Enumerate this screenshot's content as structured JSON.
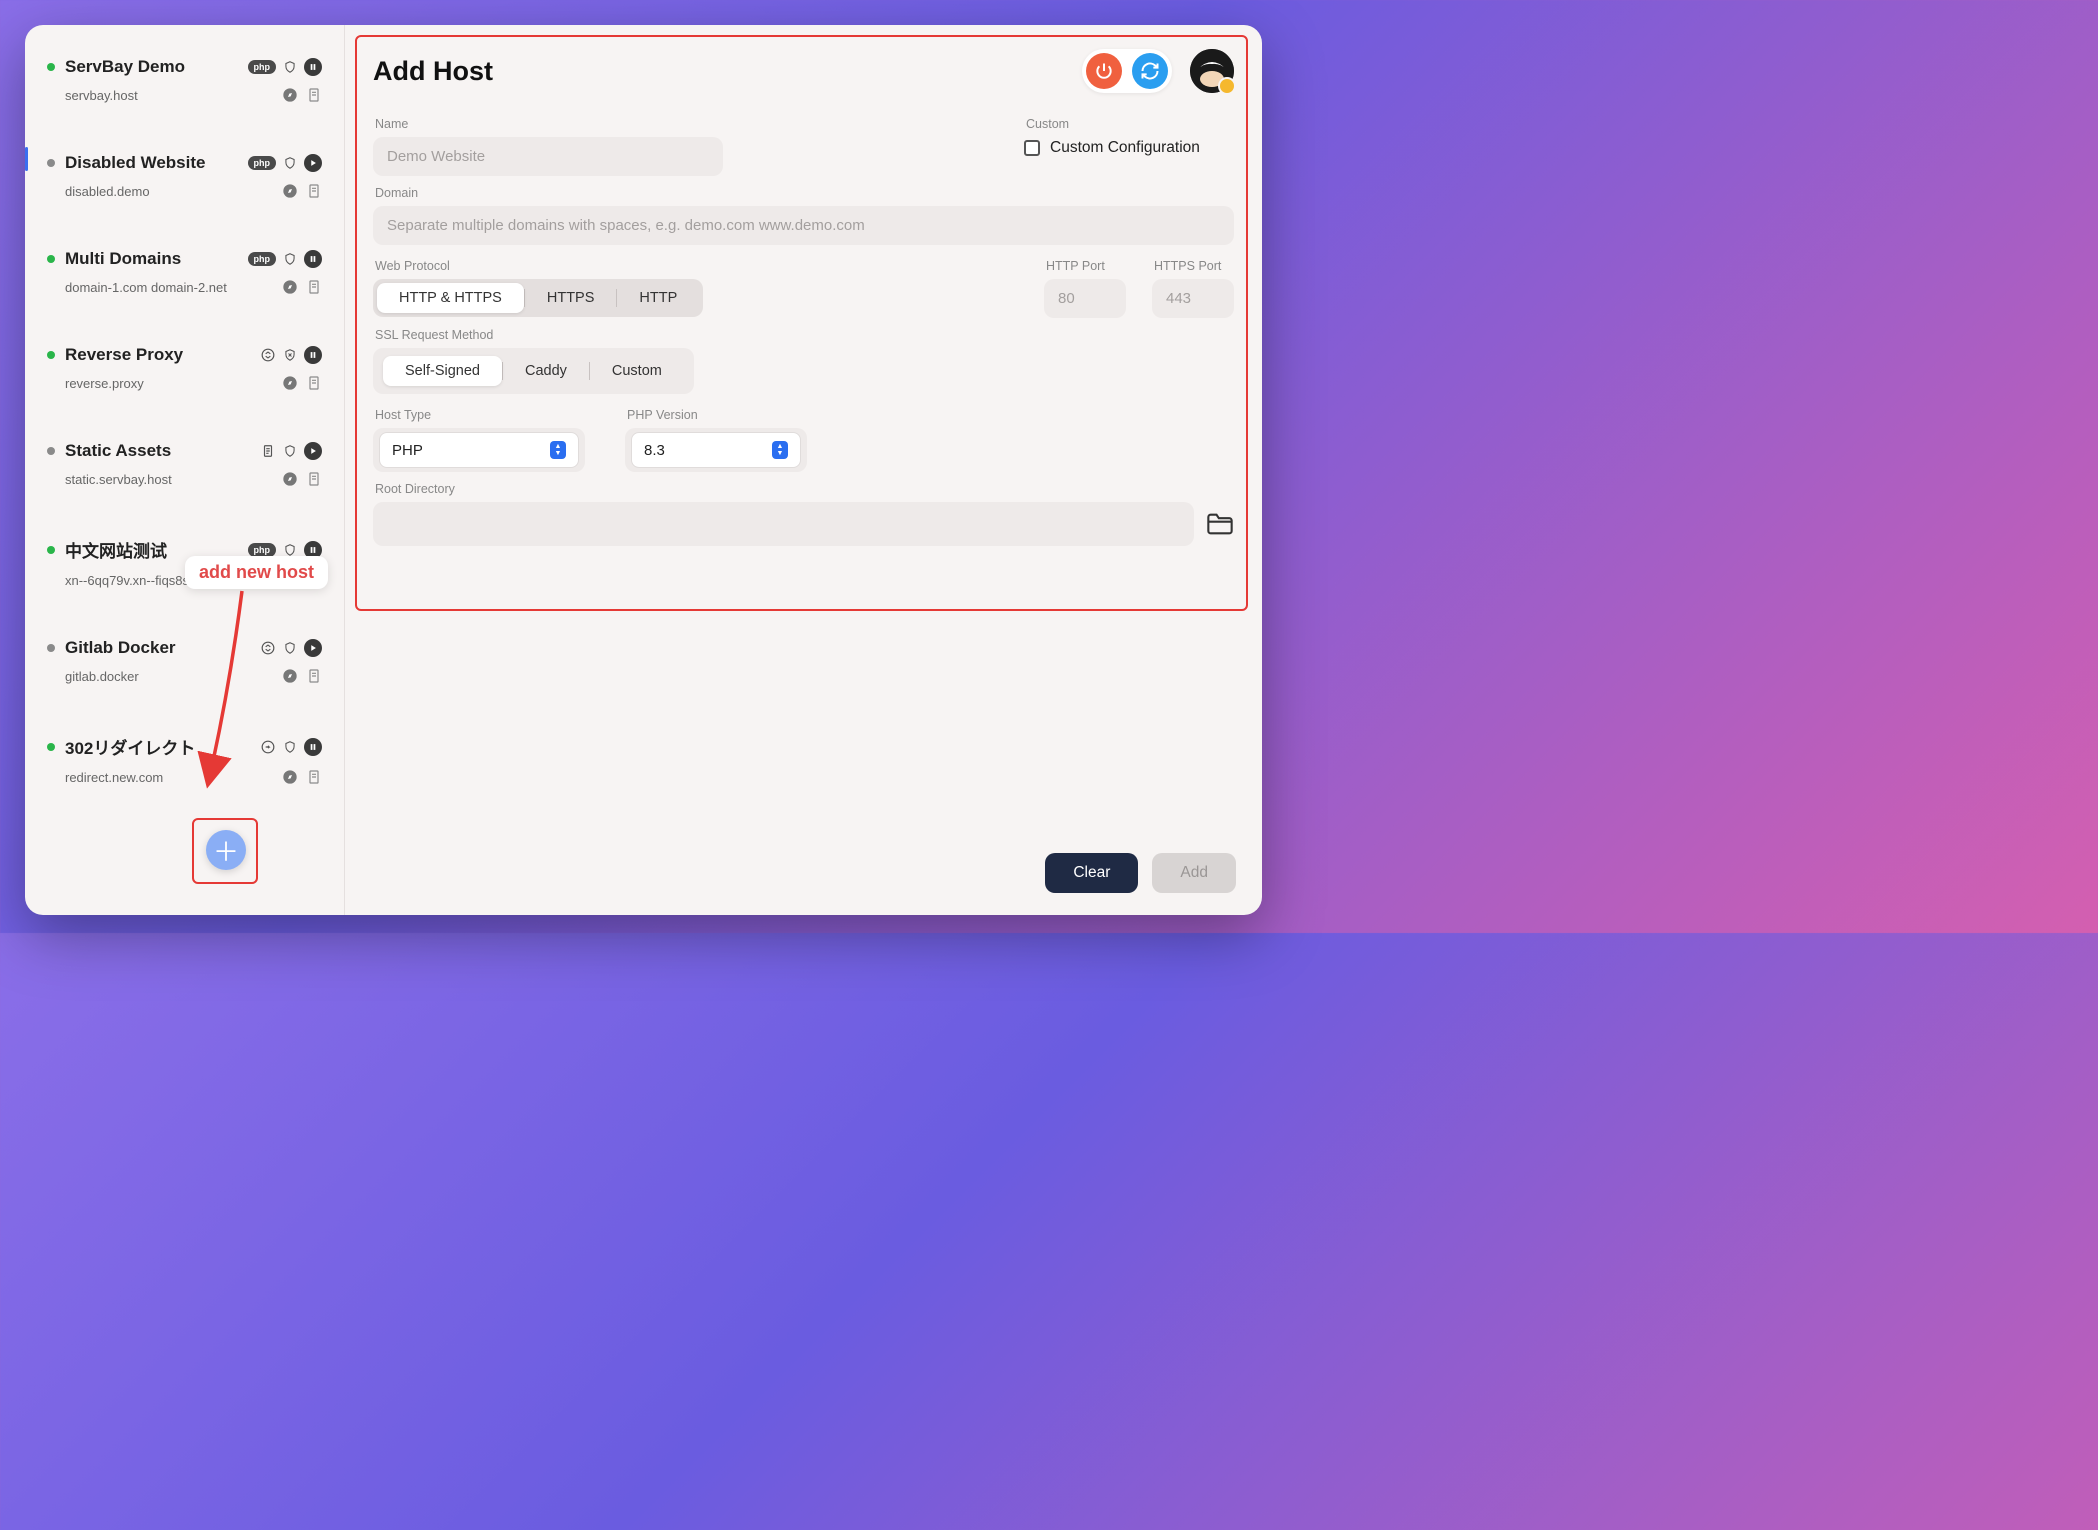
{
  "annotation": {
    "tooltip": "add new host"
  },
  "sidebar": {
    "hosts": [
      {
        "title": "ServBay Demo",
        "sub": "servbay.host",
        "status": "green",
        "badge": "php",
        "action": "pause",
        "selected": false,
        "icon1": "shield"
      },
      {
        "title": "Disabled Website",
        "sub": "disabled.demo",
        "status": "grey",
        "badge": "php",
        "action": "play",
        "selected": true,
        "icon1": "shield"
      },
      {
        "title": "Multi Domains",
        "sub": "domain-1.com domain-2.net",
        "status": "green",
        "badge": "php",
        "action": "pause",
        "selected": false,
        "icon1": "shield"
      },
      {
        "title": "Reverse Proxy",
        "sub": "reverse.proxy",
        "status": "green",
        "badge": "swap",
        "action": "pause",
        "selected": false,
        "icon1": "shield-x"
      },
      {
        "title": "Static Assets",
        "sub": "static.servbay.host",
        "status": "grey",
        "badge": "doc",
        "action": "play",
        "selected": false,
        "icon1": "shield"
      },
      {
        "title": "中文网站测试",
        "sub": "xn--6qq79v.xn--fiqs8s",
        "status": "green",
        "badge": "php",
        "action": "pause",
        "selected": false,
        "icon1": "shield"
      },
      {
        "title": "Gitlab Docker",
        "sub": "gitlab.docker",
        "status": "grey",
        "badge": "swap",
        "action": "play",
        "selected": false,
        "icon1": "shield"
      },
      {
        "title": "302リダイレクト",
        "sub": "redirect.new.com",
        "status": "green",
        "badge": "redir",
        "action": "pause",
        "selected": false,
        "icon1": "shield"
      }
    ]
  },
  "main": {
    "title": "Add Host",
    "labels": {
      "name": "Name",
      "domain": "Domain",
      "protocol": "Web Protocol",
      "ssl": "SSL Request Method",
      "hosttype": "Host Type",
      "phpver": "PHP Version",
      "rootdir": "Root Directory",
      "custom": "Custom",
      "httpport": "HTTP Port",
      "httpsport": "HTTPS Port"
    },
    "placeholders": {
      "name": "Demo Website",
      "domain": "Separate multiple domains with spaces, e.g. demo.com www.demo.com",
      "httpport": "80",
      "httpsport": "443"
    },
    "custom_config_label": "Custom Configuration",
    "protocol_options": [
      "HTTP & HTTPS",
      "HTTPS",
      "HTTP"
    ],
    "protocol_selected": 0,
    "ssl_options": [
      "Self-Signed",
      "Caddy",
      "Custom"
    ],
    "ssl_selected": 0,
    "hosttype_value": "PHP",
    "phpver_value": "8.3",
    "footer": {
      "clear": "Clear",
      "add": "Add"
    }
  }
}
